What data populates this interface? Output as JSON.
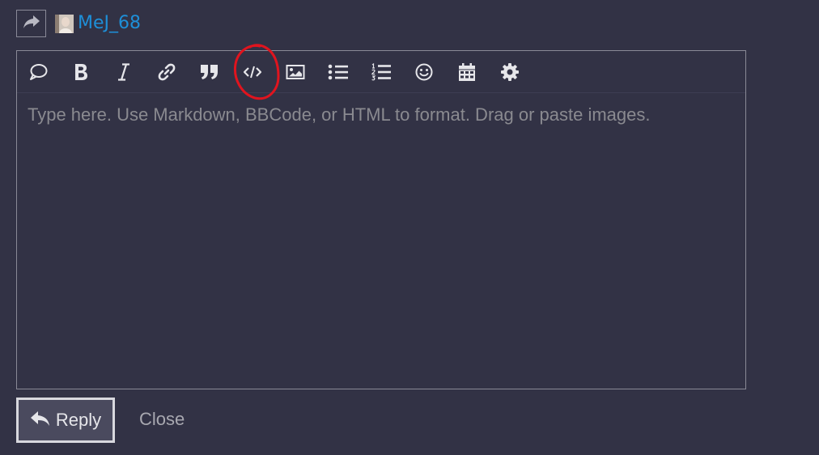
{
  "reply_bar": {
    "reply_type_icon": "share-arrow-icon",
    "username": "MeJ_68"
  },
  "toolbar": {
    "tools": [
      {
        "name": "quote-bubble",
        "icon": "speech-bubble-icon"
      },
      {
        "name": "bold",
        "icon": "bold-icon"
      },
      {
        "name": "italic",
        "icon": "italic-icon"
      },
      {
        "name": "link",
        "icon": "link-icon"
      },
      {
        "name": "blockquote",
        "icon": "quote-icon"
      },
      {
        "name": "code",
        "icon": "code-icon"
      },
      {
        "name": "image",
        "icon": "image-icon"
      },
      {
        "name": "bulleted-list",
        "icon": "bulleted-list-icon"
      },
      {
        "name": "numbered-list",
        "icon": "numbered-list-icon"
      },
      {
        "name": "emoji",
        "icon": "smiley-icon"
      },
      {
        "name": "date",
        "icon": "calendar-icon"
      },
      {
        "name": "settings",
        "icon": "gear-icon"
      }
    ],
    "highlighted_tool": "code",
    "highlight_color": "#e0141e"
  },
  "composer": {
    "placeholder": "Type here. Use Markdown, BBCode, or HTML to format. Drag or paste images."
  },
  "actions": {
    "reply_label": "Reply",
    "close_label": "Close"
  },
  "colors": {
    "background": "#323245",
    "link": "#1e8fd8",
    "icon": "#e6e6ea"
  }
}
